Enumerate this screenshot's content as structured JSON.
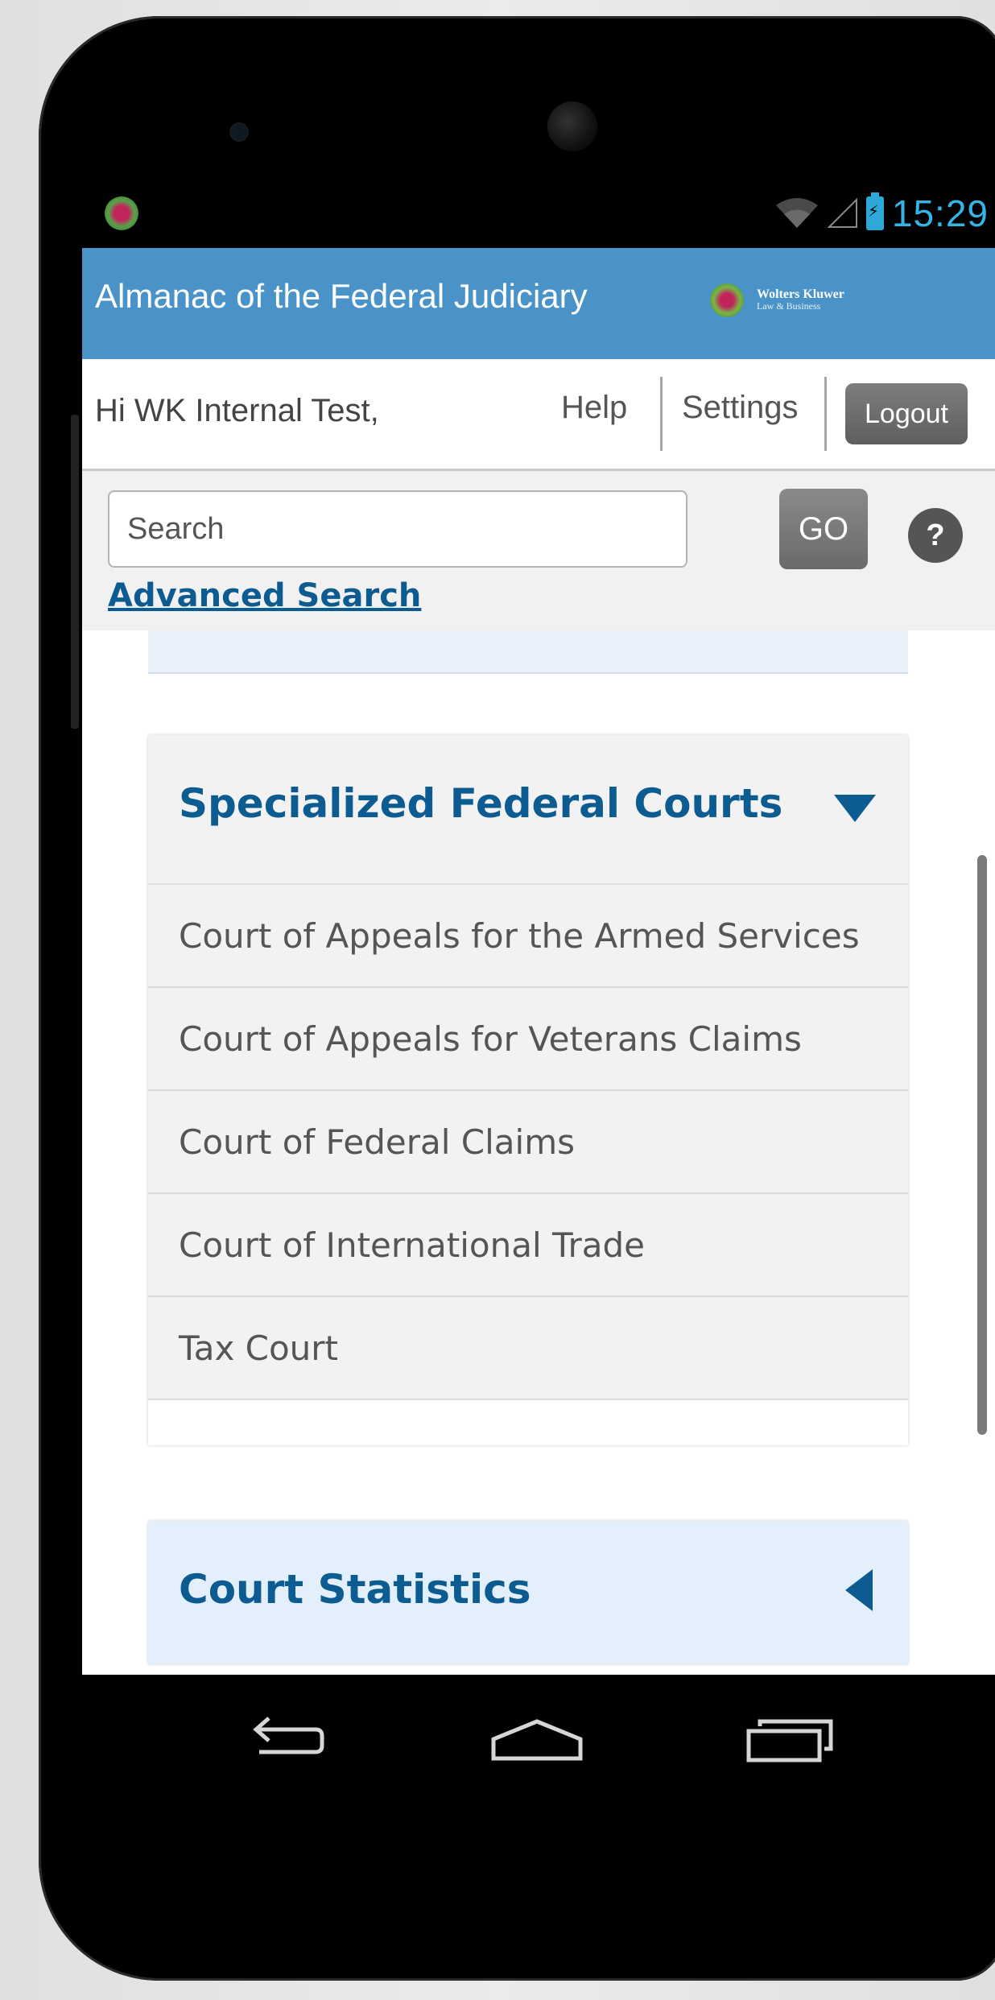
{
  "status_bar": {
    "time": "15:29",
    "icons": [
      "app-notification-icon",
      "wifi-icon",
      "signal-icon",
      "battery-charging-icon"
    ]
  },
  "app_header": {
    "title": "Almanac of the Federal Judiciary",
    "brand_name": "Wolters Kluwer",
    "brand_sub": "Law & Business"
  },
  "user_bar": {
    "greeting": "Hi WK Internal Test,",
    "help_label": "Help",
    "settings_label": "Settings",
    "logout_label": "Logout"
  },
  "search": {
    "placeholder": "Search",
    "go_label": "GO",
    "help_icon": "?",
    "advanced_label": "Advanced Search"
  },
  "sections": {
    "specialized": {
      "title": "Specialized Federal Courts",
      "expanded": true,
      "items": [
        "Court of Appeals for the Armed Services",
        "Court of Appeals for Veterans Claims",
        "Court of Federal Claims",
        "Court of International Trade",
        "Tax Court"
      ]
    },
    "statistics": {
      "title": "Court Statistics",
      "expanded": false
    }
  },
  "colors": {
    "header_blue": "#4a93c9",
    "link_blue": "#0d5c91",
    "clock_blue": "#33b5e5"
  }
}
